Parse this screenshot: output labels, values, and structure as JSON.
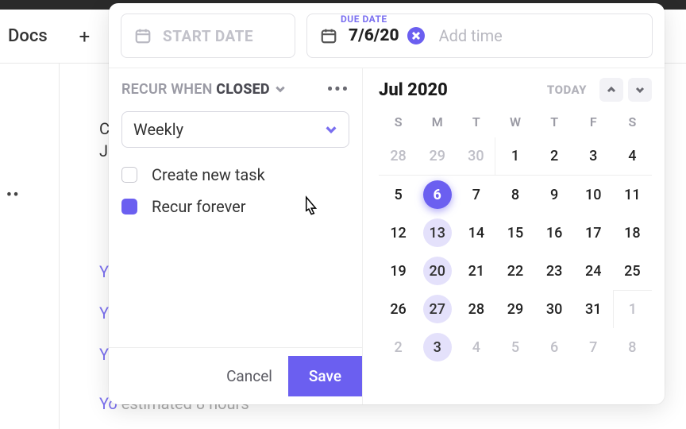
{
  "bg": {
    "docs": "Docs",
    "line1": "CR",
    "line2": "Ju",
    "link": "Yo",
    "foot_y": "Yo",
    "foot_rest": " estimated 8 hours"
  },
  "dates": {
    "start_placeholder": "START DATE",
    "due_label": "DUE DATE",
    "due_value": "7/6/20",
    "add_time": "Add time"
  },
  "recur": {
    "when": "RECUR WHEN ",
    "closed": "CLOSED",
    "frequency": "Weekly",
    "create_new_label": "Create new task",
    "create_new_checked": false,
    "recur_forever_label": "Recur forever",
    "recur_forever_checked": true
  },
  "actions": {
    "cancel": "Cancel",
    "save": "Save"
  },
  "calendar": {
    "month": "Jul 2020",
    "today_label": "TODAY",
    "dow": [
      "S",
      "M",
      "T",
      "W",
      "T",
      "F",
      "S"
    ],
    "selected": 6,
    "highlighted": [
      13,
      20,
      27
    ],
    "next_highlighted": [
      3
    ],
    "prev_trail": [
      28,
      29,
      30
    ],
    "days": [
      1,
      2,
      3,
      4,
      5,
      6,
      7,
      8,
      9,
      10,
      11,
      12,
      13,
      14,
      15,
      16,
      17,
      18,
      19,
      20,
      21,
      22,
      23,
      24,
      25,
      26,
      27,
      28,
      29,
      30,
      31
    ],
    "next_lead": [
      1,
      2,
      3,
      4,
      5,
      6,
      7,
      8
    ]
  }
}
